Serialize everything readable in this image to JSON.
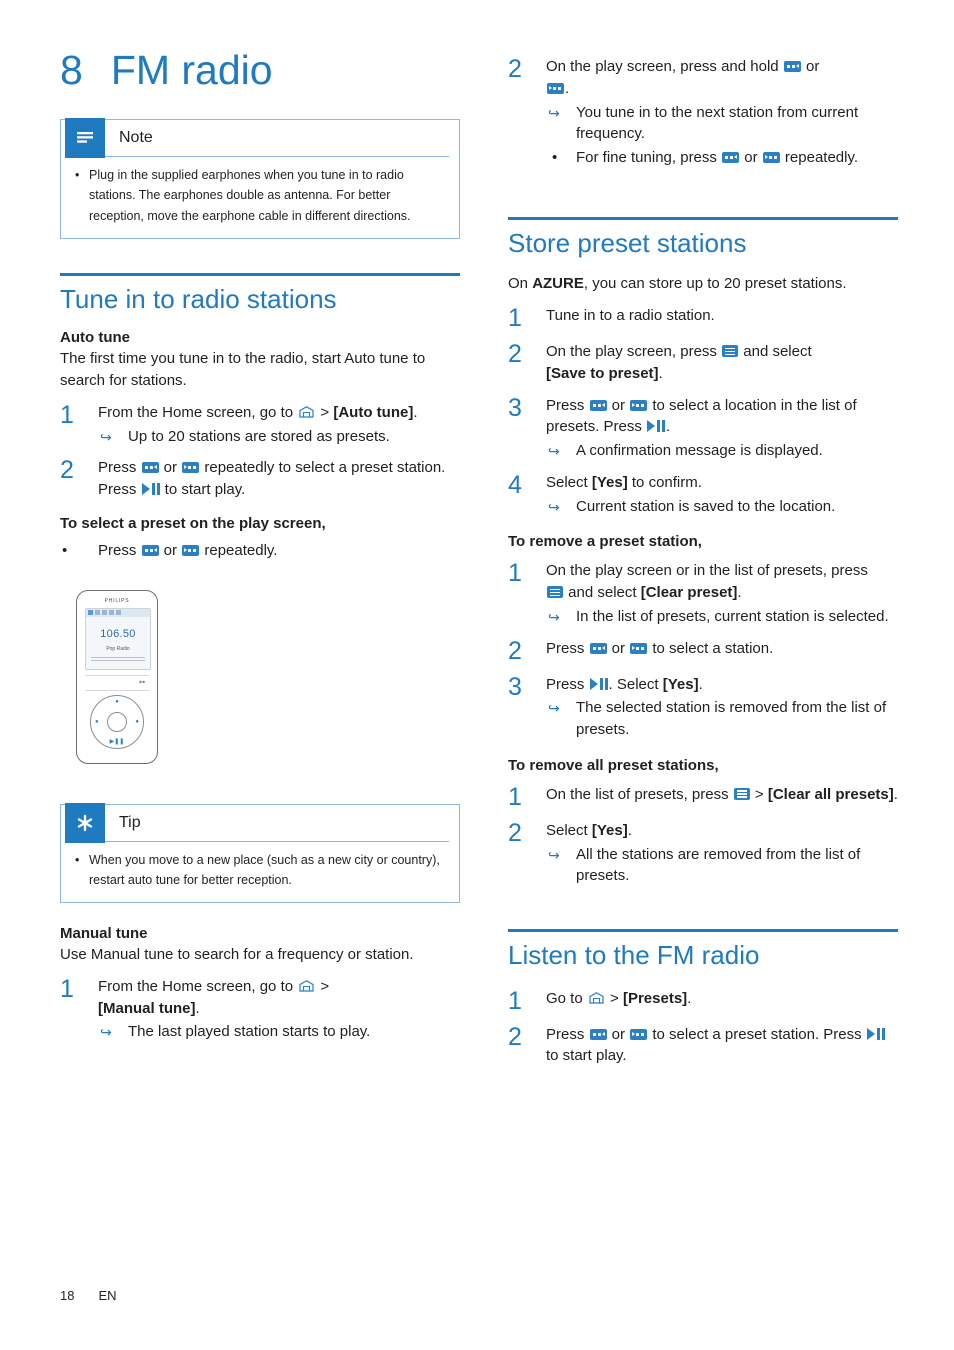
{
  "chapter": {
    "number": "8",
    "title": "FM radio"
  },
  "note": {
    "title": "Note",
    "items": [
      "Plug in the supplied earphones when you tune in to radio stations. The earphones double as antenna. For better reception, move the earphone cable in different directions."
    ]
  },
  "tip": {
    "title": "Tip",
    "items": [
      "When you move to a new place (such as a new city or country), restart auto tune for better reception."
    ]
  },
  "sections": {
    "tune_in": {
      "heading": "Tune in to radio stations",
      "auto_tune": {
        "sub": "Auto tune",
        "intro": "The first time you tune in to the radio, start Auto tune to search for stations.",
        "step1_num": "1",
        "step1_a": "From the Home screen, go to ",
        "step1_b": " > ",
        "step1_bold": "[Auto tune]",
        "step1_c": ".",
        "step1_result": "Up to 20 stations are stored as presets.",
        "step2_num": "2",
        "step2_a": "Press ",
        "step2_or": " or ",
        "step2_b": " repeatedly to select a preset station. Press ",
        "step2_c": " to start play."
      },
      "select_preset": {
        "heading": "To select a preset on the play screen,",
        "bullet_a": "Press ",
        "bullet_or": " or ",
        "bullet_b": " repeatedly."
      },
      "manual_tune": {
        "sub": "Manual tune",
        "intro": "Use Manual tune to search for a frequency or station.",
        "step1_num": "1",
        "step1_a": "From the Home screen, go to ",
        "step1_b": " > ",
        "step1_bold": "[Manual tune]",
        "step1_c": ".",
        "step1_result": "The last played station starts to play."
      }
    },
    "store_preset": {
      "heading": "Store preset stations",
      "intro_a": "On ",
      "intro_bold": "AZURE",
      "intro_b": ", you can store up to 20 preset stations.",
      "step1_num": "1",
      "step1_text": "Tune in to a radio station.",
      "step2_num": "2",
      "step2_a": "On the play screen, press ",
      "step2_b": " and select ",
      "step2_bold": "[Save to preset]",
      "step2_c": ".",
      "step3_num": "3",
      "step3_a": "Press ",
      "step3_or": " or ",
      "step3_b": " to select a location in the list of presets. Press ",
      "step3_c": ".",
      "step3_result": "A confirmation message is displayed.",
      "step4_num": "4",
      "step4_a": "Select ",
      "step4_bold": "[Yes]",
      "step4_b": " to confirm.",
      "step4_result": "Current station is saved to the location."
    },
    "remove_preset": {
      "heading": "To remove a preset station,",
      "step1_num": "1",
      "step1_a": "On the play screen or in the list of presets, press ",
      "step1_b": " and select ",
      "step1_bold": "[Clear preset]",
      "step1_c": ".",
      "step1_result": "In the list of presets, current station is selected.",
      "step2_num": "2",
      "step2_a": "Press ",
      "step2_or": " or ",
      "step2_b": " to select a station.",
      "step3_num": "3",
      "step3_a": "Press ",
      "step3_b": ". Select ",
      "step3_bold": "[Yes]",
      "step3_c": ".",
      "step3_result": "The selected station is removed from the list of presets."
    },
    "remove_all": {
      "heading": "To remove all preset stations,",
      "step1_num": "1",
      "step1_a": "On the list of presets, press ",
      "step1_b": " > ",
      "step1_bold": "[Clear all presets]",
      "step1_c": ".",
      "step2_num": "2",
      "step2_a": "Select ",
      "step2_bold": "[Yes]",
      "step2_b": ".",
      "step2_result": "All the stations are removed from the list of presets."
    },
    "listen": {
      "heading": "Listen to the FM radio",
      "step1_num": "1",
      "step1_a": "Go to ",
      "step1_b": " > ",
      "step1_bold": "[Presets]",
      "step1_c": ".",
      "step2_num": "2",
      "step2_a": "Press ",
      "step2_or": " or ",
      "step2_b": " to select a preset station. Press ",
      "step2_c": " to start play."
    }
  },
  "right_top": {
    "step2_num": "2",
    "step2_a": "On the play screen, press and hold ",
    "step2_or": " or ",
    "step2_b": ".",
    "step2_result": "You tune in to the next station from current frequency.",
    "bullet_a": "For fine tuning, press ",
    "bullet_or": " or ",
    "bullet_b": " repeatedly."
  },
  "player_image": {
    "brand": "PHILIPS",
    "frequency": "106.50",
    "station_label": "Pop Radio"
  },
  "footer": {
    "page": "18",
    "lang": "EN"
  },
  "colors": {
    "accent": "#1f7ac0",
    "icon": "#2b7fc3",
    "text": "#231f20"
  }
}
